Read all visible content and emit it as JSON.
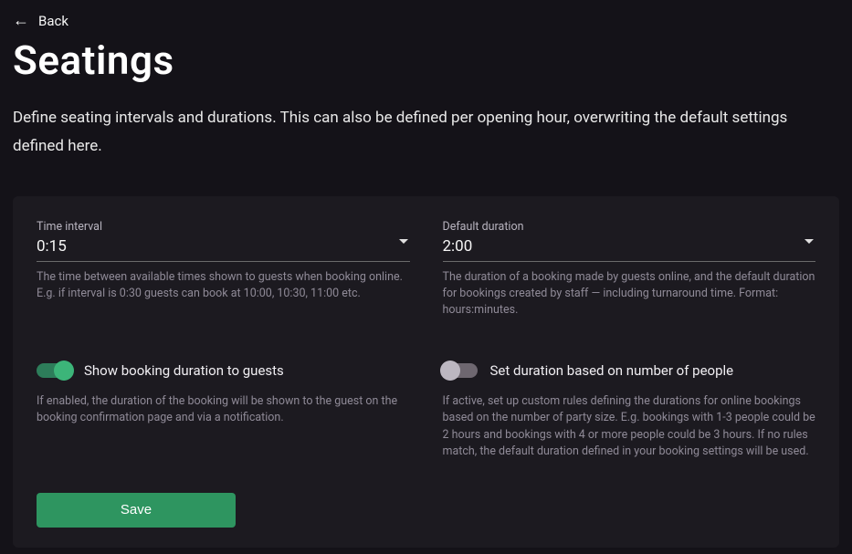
{
  "back": {
    "label": "Back"
  },
  "header": {
    "title": "Seatings",
    "description": "Define seating intervals and durations. This can also be defined per opening hour, overwriting the default settings defined here."
  },
  "timeInterval": {
    "label": "Time interval",
    "value": "0:15",
    "helper": "The time between available times shown to guests when booking online. E.g. if interval is 0:30 guests can book at 10:00, 10:30, 11:00 etc."
  },
  "defaultDuration": {
    "label": "Default duration",
    "value": "2:00",
    "helper": "The duration of a booking made by guests online, and the default duration for bookings created by staff — including turnaround time. Format: hours:minutes."
  },
  "showDuration": {
    "label": "Show booking duration to guests",
    "helper": "If enabled, the duration of the booking will be shown to the guest on the booking confirmation page and via a notification."
  },
  "durationByPeople": {
    "label": "Set duration based on number of people",
    "helper": "If active, set up custom rules defining the durations for online bookings based on the number of party size. E.g. bookings with 1-3 people could be 2 hours and bookings with 4 or more people could be 3 hours. If no rules match, the default duration defined in your booking settings will be used."
  },
  "actions": {
    "save": "Save"
  }
}
